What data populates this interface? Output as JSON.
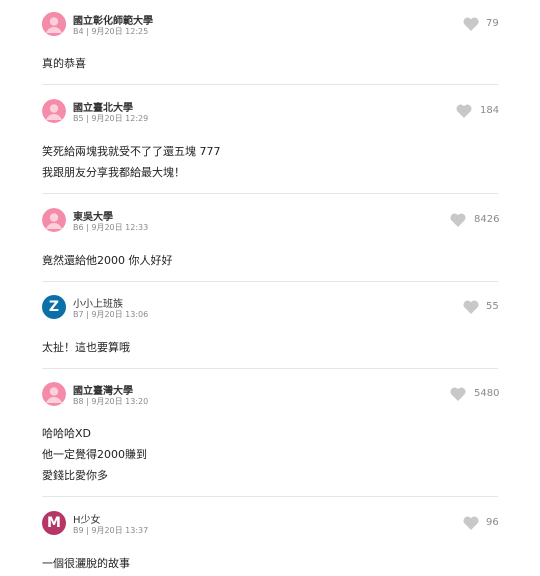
{
  "colors": {
    "avatar_pink": "#f48ba9",
    "avatar_z": "#0d6fa8",
    "avatar_m": "#b53765",
    "heart_gray": "#c8c8c8"
  },
  "comments": [
    {
      "author": "國立彰化師範大學",
      "floor_time": "B4 | 9月20日 12:25",
      "likes": "79",
      "avatar_type": "pink-person-icon",
      "lines": [
        "真的恭喜"
      ]
    },
    {
      "author": "國立臺北大學",
      "floor_time": "B5 | 9月20日 12:29",
      "likes": "184",
      "avatar_type": "pink-person-icon",
      "lines": [
        "笑死給兩塊我就受不了了還五塊 777",
        "我跟朋友分享我都給最大塊！"
      ]
    },
    {
      "author": "東吳大學",
      "floor_time": "B6 | 9月20日 12:33",
      "likes": "8426",
      "avatar_type": "pink-person-icon",
      "lines": [
        "竟然還給他2000 你人好好"
      ]
    },
    {
      "author": "小小上班族",
      "floor_time": "B7 | 9月20日 13:06",
      "likes": "55",
      "avatar_type": "letter",
      "avatar_letter": "Z",
      "lines": [
        "太扯！這也要算哦"
      ]
    },
    {
      "author": "國立臺灣大學",
      "floor_time": "B8 | 9月20日 13:20",
      "likes": "5480",
      "avatar_type": "pink-person-icon",
      "lines": [
        "哈哈哈XD",
        "他一定覺得2000賺到",
        "愛錢比愛你多"
      ]
    },
    {
      "author": "H少女",
      "floor_time": "B9 | 9月20日 13:37",
      "likes": "96",
      "avatar_type": "letter",
      "avatar_letter": "M",
      "lines": [
        "一個很灑脫的故事"
      ]
    }
  ]
}
